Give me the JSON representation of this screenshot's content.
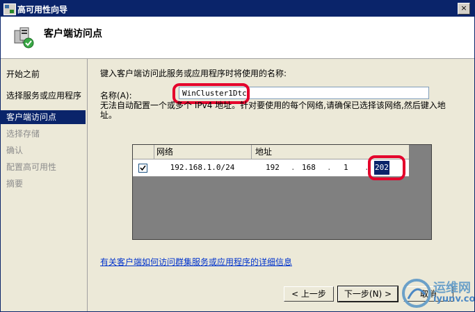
{
  "window": {
    "title": "高可用性向导",
    "close_glyph": "×"
  },
  "header": {
    "title": "客户端访问点"
  },
  "nav": {
    "items": [
      {
        "label": "开始之前",
        "state": "normal"
      },
      {
        "label": "选择服务或应用程序",
        "state": "normal"
      },
      {
        "label": "客户端访问点",
        "state": "active"
      },
      {
        "label": "选择存储",
        "state": "disabled"
      },
      {
        "label": "确认",
        "state": "disabled"
      },
      {
        "label": "配置高可用性",
        "state": "disabled"
      },
      {
        "label": "摘要",
        "state": "disabled"
      }
    ]
  },
  "main": {
    "prompt": "键入客户端访问此服务或应用程序时将使用的名称:",
    "name_label": "名称(A):",
    "name_value": "WinCluster1Dtc",
    "warning": "无法自动配置一个或多个 IPv4 地址。针对要使用的每个网络,请确保已选择该网络,然后键入地址。",
    "grid": {
      "col_network": "网络",
      "col_address": "地址",
      "rows": [
        {
          "checked": true,
          "network": "192.168.1.0/24",
          "octets": [
            "192",
            "168",
            "1",
            "202"
          ]
        }
      ]
    },
    "link": "有关客户端如何访问群集服务或应用程序的详细信息"
  },
  "buttons": {
    "back": "< 上一步",
    "next": "下一步(N) >",
    "cancel": "取消"
  },
  "watermark": {
    "line1": "运维网",
    "line2": "iyunv.com"
  },
  "colors": {
    "highlight": "#e4002b",
    "selection": "#0a246a",
    "titlebar": "#0a246a"
  }
}
